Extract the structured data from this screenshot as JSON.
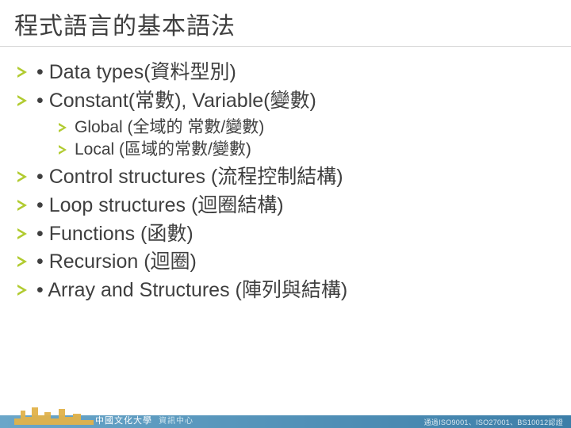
{
  "title": "程式語言的基本語法",
  "bullets": {
    "b1": "• Data types(資料型別)",
    "b2": "• Constant(常數), Variable(變數)",
    "b2a": " Global (全域的 常數/變數)",
    "b2b": "Local (區域的常數/變數)",
    "b3": "• Control structures (流程控制結構)",
    "b4": "• Loop structures (迴圈結構)",
    "b5": "• Functions (函數)",
    "b6": "• Recursion (迴圈)",
    "b7": "• Array and Structures (陣列與結構)"
  },
  "footer": {
    "brand_main": "中國文化大學",
    "brand_sub": "資訊中心",
    "cert": "通過ISO9001、ISO27001、BS10012認證"
  },
  "colors": {
    "accent": "#b1cb30",
    "title_border": "#d9d9d9",
    "footer_grad_left": "#6aa6c9",
    "footer_grad_right": "#3c7ea8"
  }
}
